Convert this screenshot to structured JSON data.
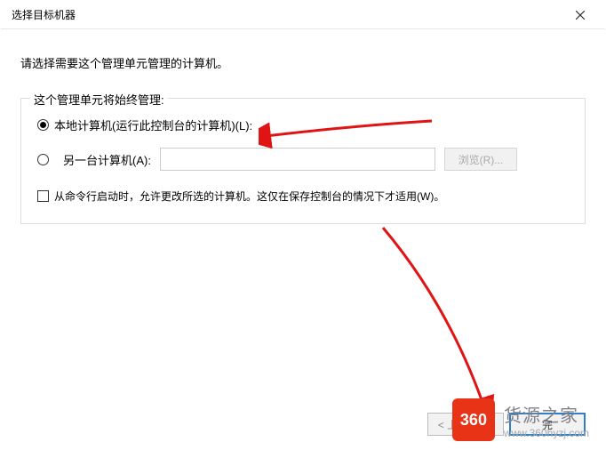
{
  "titlebar": {
    "title": "选择目标机器"
  },
  "instruction": "请选择需要这个管理单元管理的计算机。",
  "group": {
    "legend": "这个管理单元将始终管理:",
    "localLabel": "本地计算机(运行此控制台的计算机)(L):",
    "anotherLabel": "另一台计算机(A):",
    "anotherValue": "",
    "browseLabel": "浏览(R)...",
    "checkboxLabel": "从命令行启动时，允许更改所选的计算机。这仅在保存控制台的情况下才适用(W)。"
  },
  "footer": {
    "back": "< 上一步(B)",
    "finish": "完"
  },
  "watermark": {
    "badge": "360",
    "title": "货源之家",
    "url": "www.360hyzj.com"
  }
}
